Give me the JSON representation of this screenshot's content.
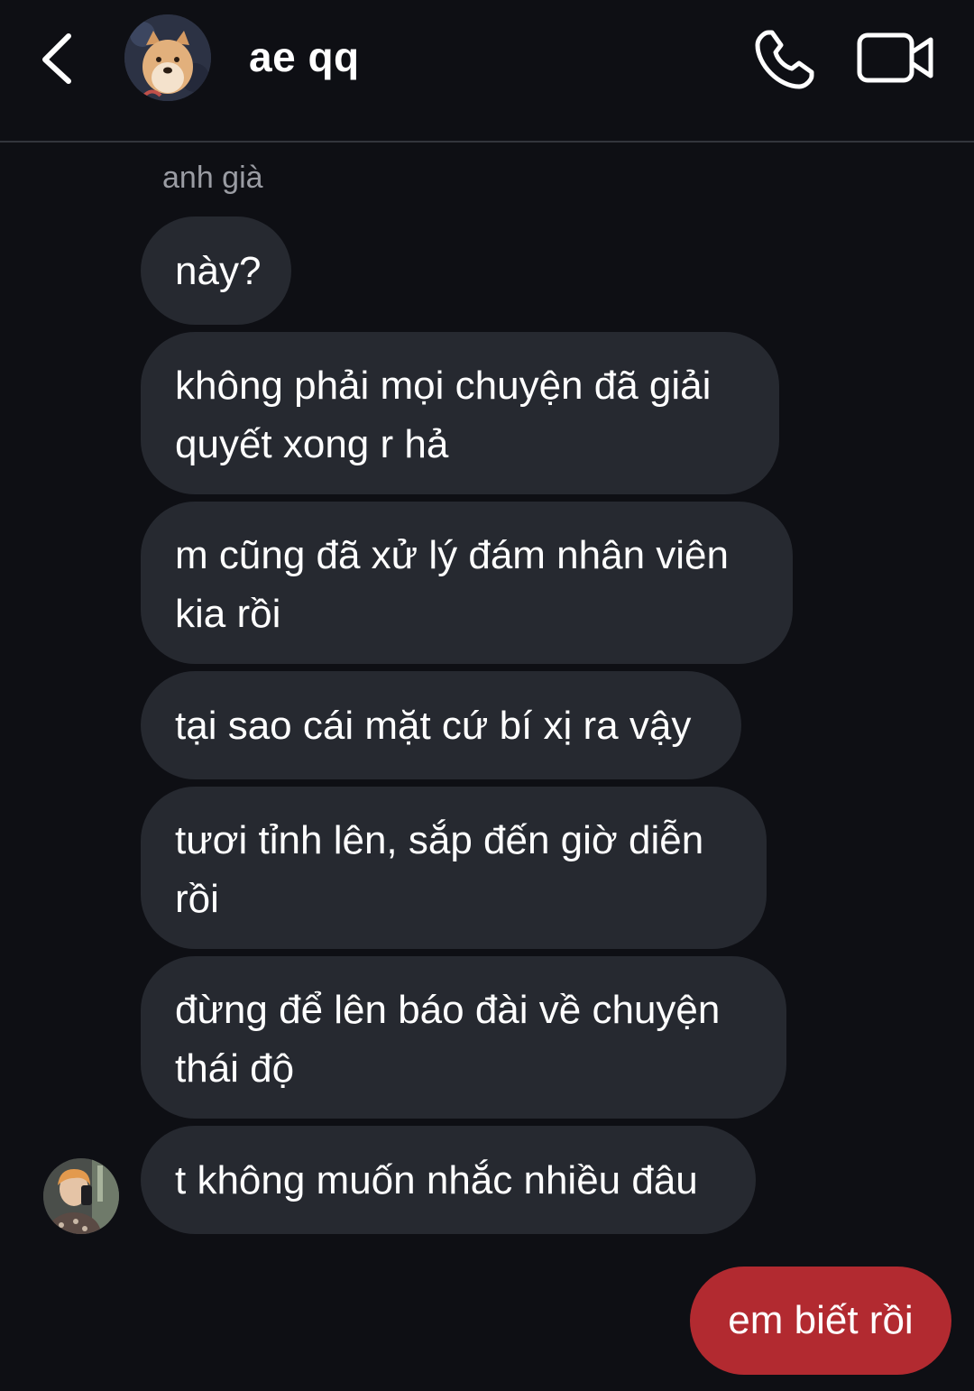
{
  "header": {
    "title": "ae qq",
    "back_icon": "chevron-left-icon",
    "call_icon": "phone-icon",
    "video_icon": "video-camera-icon"
  },
  "conversation": {
    "sender_name": "anh già",
    "incoming_messages": [
      {
        "lines": [
          "này?"
        ]
      },
      {
        "lines": [
          "không phải mọi chuyện đã giải",
          "quyết xong r hả"
        ]
      },
      {
        "lines": [
          "m cũng đã xử lý đám nhân viên",
          "kia rồi"
        ]
      },
      {
        "lines": [
          "tại sao cái mặt cứ bí xị ra vậy"
        ]
      },
      {
        "lines": [
          "tươi tỉnh lên, sắp đến giờ diễn",
          "rồi"
        ]
      },
      {
        "lines": [
          "đừng để lên báo đài về chuyện",
          "thái độ"
        ]
      },
      {
        "lines": [
          "t không muốn nhắc nhiều đâu"
        ]
      }
    ],
    "outgoing_messages": [
      {
        "text": "em biết rồi"
      }
    ]
  },
  "colors": {
    "background": "#0e0f14",
    "incoming_bubble": "#262930",
    "outgoing_bubble": "#b22a30",
    "sender_name": "#9a9ca3",
    "divider": "#33353c"
  }
}
